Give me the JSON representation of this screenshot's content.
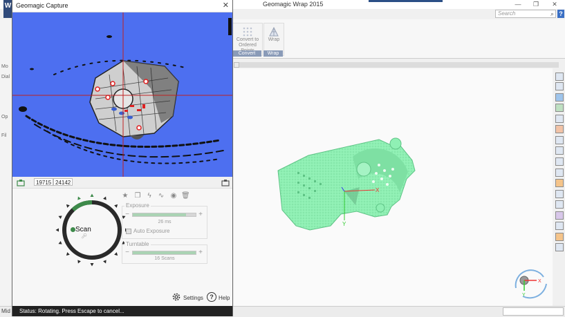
{
  "wrap": {
    "title": "Geomagic Wrap 2015",
    "logo": "W",
    "controls": {
      "minimize": "—",
      "restore": "❐",
      "close": "✕"
    },
    "search_placeholder": "Search",
    "help_label": "?",
    "ribbon": {
      "convert_button": "Convert to Ordered Points",
      "wrap_button": "Wrap",
      "groups": {
        "convert": "Convert",
        "wrap": "Wrap"
      }
    },
    "left_stubs": [
      "Mo",
      "Dial",
      "Op",
      "Fil"
    ],
    "status_text": "Mid",
    "model_color": "#8ff0b4"
  },
  "capture": {
    "title": "Geomagic Capture",
    "close_label": "✕",
    "counts": [
      "19715",
      "24142"
    ],
    "scan_label": "Scan",
    "exposure": {
      "title": "Exposure",
      "value": "26 ms",
      "fraction": 0.85,
      "auto_label": "Auto Exposure"
    },
    "turntable": {
      "title": "Turntable",
      "value": "16 Scans",
      "fraction": 1.0
    },
    "settings_label": "Settings",
    "help_label": "Help",
    "status_text": "Status:  Rotating. Press Escape to cancel...",
    "progress_fraction": 0.12,
    "colors": {
      "scan_background": "#4d6ff0",
      "accent_green": "#3d8a4a"
    }
  }
}
